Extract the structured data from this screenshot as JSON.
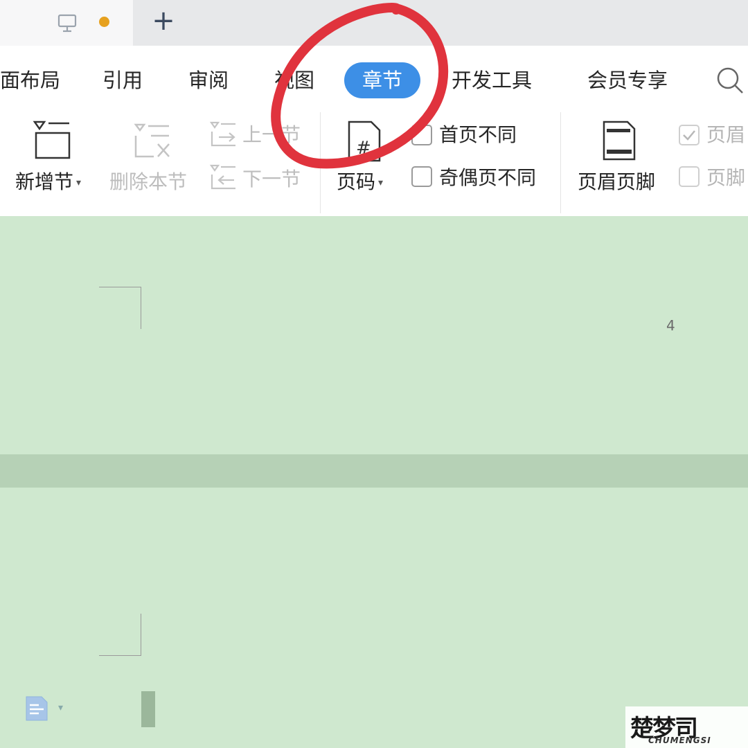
{
  "menu": {
    "items": [
      "面布局",
      "引用",
      "审阅",
      "视图",
      "章节",
      "开发工具",
      "会员专享"
    ],
    "active": "章节"
  },
  "toolbar": {
    "add_section": "新增节",
    "delete_section": "删除本节",
    "prev_section": "上一节",
    "next_section": "下一节",
    "page_number": "页码",
    "first_page_different": "首页不同",
    "odd_even_different": "奇偶页不同",
    "header_footer": "页眉页脚",
    "header_partial": "页眉",
    "footer_partial": "页脚"
  },
  "document": {
    "page_number": "4"
  },
  "watermark": {
    "brand": "楚梦司",
    "sub": "CHUMENGSI"
  },
  "colors": {
    "accent": "#3d8fe6",
    "doc_background": "#cfe8cf",
    "annotation": "#e0333d",
    "tab_dot": "#e6a11f"
  },
  "icons": [
    "monitor-icon",
    "plus-icon",
    "search-icon",
    "add-section-icon",
    "delete-section-icon",
    "prev-section-icon",
    "next-section-icon",
    "page-number-icon",
    "header-footer-icon",
    "document-format-icon"
  ]
}
